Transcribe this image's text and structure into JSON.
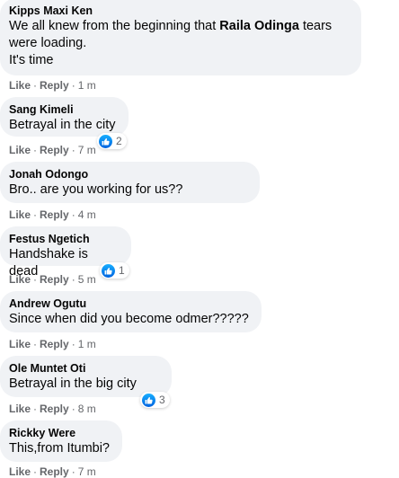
{
  "labels": {
    "like": "Like",
    "reply": "Reply",
    "sep": "·"
  },
  "colors": {
    "bubble": "#f0f2f5",
    "meta": "#65676b",
    "like_blue": "#1877f2"
  },
  "comments": [
    {
      "author": "Kipps Maxi Ken",
      "text_pre": "We all knew from the beginning that ",
      "text_bold": "Raila Odinga",
      "text_post": " tears\nwere loading.\nIt's time",
      "time": "1 m"
    },
    {
      "author": "Sang Kimeli",
      "text": "Betrayal in the city",
      "time": "7 m",
      "likes": "2"
    },
    {
      "author": "Jonah Odongo",
      "text": "Bro.. are you working for us??",
      "time": "4 m"
    },
    {
      "author": "Festus Ngetich",
      "text": "Handshake is dead",
      "time": "5 m",
      "likes": "1"
    },
    {
      "author": "Andrew Ogutu",
      "text": "Since when did you become odmer?????",
      "time": "1 m"
    },
    {
      "author": "Ole Muntet Oti",
      "text": "Betrayal in the big city",
      "time": "8 m",
      "likes": "3"
    },
    {
      "author": "Rickky Were",
      "text": "This,from Itumbi?",
      "time": "7 m"
    }
  ]
}
